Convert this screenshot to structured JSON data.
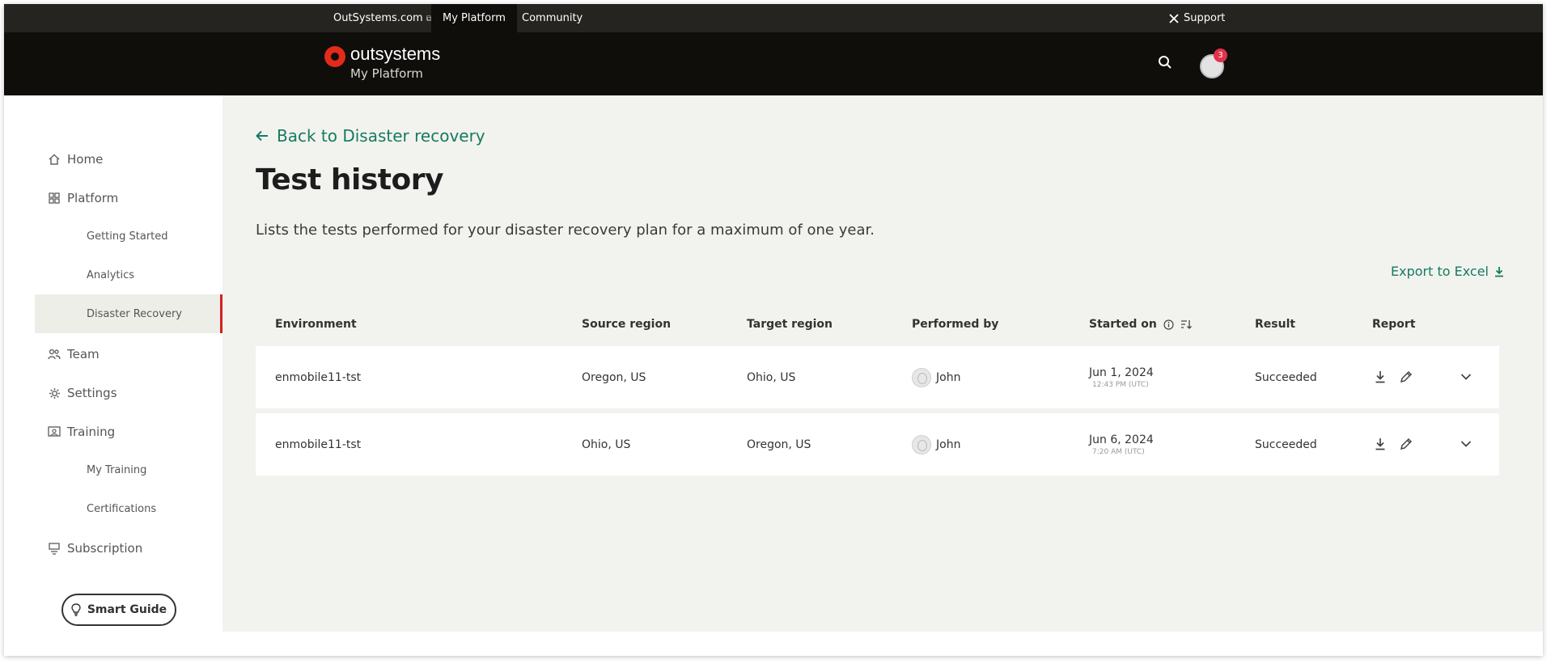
{
  "utilbar": {
    "outsystems_link": "OutSystems.com",
    "my_platform": "My Platform",
    "community": "Community",
    "support": "Support"
  },
  "header": {
    "logo_word": "outsystems",
    "logo_sub": "My Platform",
    "notification_count": "3"
  },
  "sidebar": {
    "items": [
      {
        "label": "Home",
        "icon": "home-icon"
      },
      {
        "label": "Platform",
        "icon": "grid-icon"
      },
      {
        "label": "Getting Started"
      },
      {
        "label": "Analytics"
      },
      {
        "label": "Disaster Recovery",
        "active": true
      },
      {
        "label": "Team",
        "icon": "team-icon"
      },
      {
        "label": "Settings",
        "icon": "gear-icon"
      },
      {
        "label": "Training",
        "icon": "training-icon"
      },
      {
        "label": "My Training"
      },
      {
        "label": "Certifications"
      },
      {
        "label": "Subscription",
        "icon": "subscription-icon"
      }
    ],
    "smart_guide": "Smart Guide"
  },
  "main": {
    "back_link": "Back to Disaster recovery",
    "title": "Test history",
    "description": "Lists the tests performed for your disaster recovery plan for a maximum of one year.",
    "export": "Export to Excel",
    "columns": [
      "Environment",
      "Source region",
      "Target region",
      "Performed by",
      "Started on",
      "Result",
      "Report"
    ],
    "rows": [
      {
        "environment": "enmobile11-tst",
        "source": "Oregon, US",
        "target": "Ohio, US",
        "performed_by": "John",
        "started_on": "Jun 1, 2024",
        "started_time": "12:43 PM (UTC)",
        "result": "Succeeded"
      },
      {
        "environment": "enmobile11-tst",
        "source": "Ohio, US",
        "target": "Oregon, US",
        "performed_by": "John",
        "started_on": "Jun 6, 2024",
        "started_time": "7:20 AM (UTC)",
        "result": "Succeeded"
      }
    ]
  },
  "colors": {
    "accent_green": "#167a62",
    "brand_red": "#e42a1a",
    "header_bg": "#0f0e0b",
    "main_bg": "#f2f3ee"
  }
}
